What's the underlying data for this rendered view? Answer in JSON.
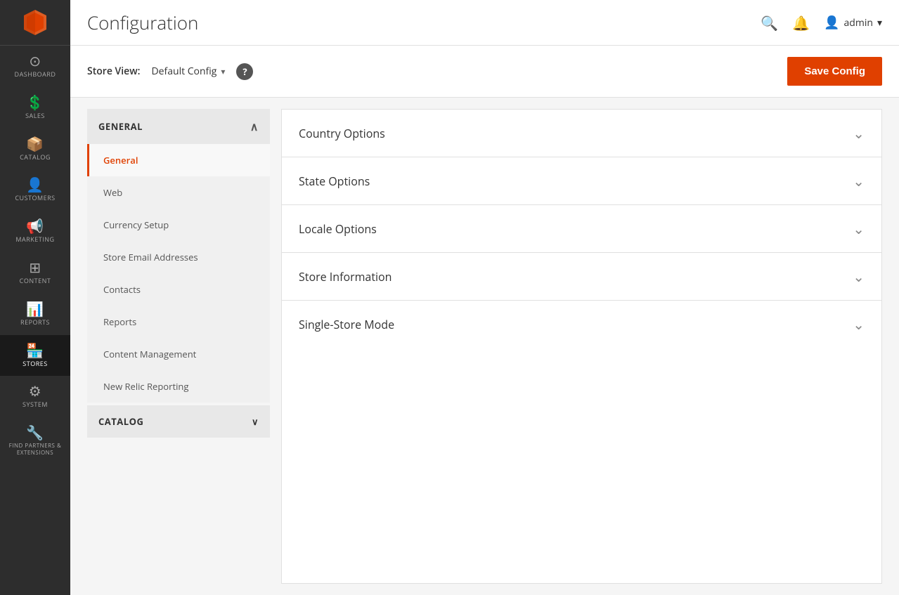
{
  "app": {
    "title": "Configuration"
  },
  "topbar": {
    "title": "Configuration",
    "user_label": "admin",
    "search_icon": "🔍",
    "bell_icon": "🔔",
    "user_icon": "👤",
    "chevron": "▾"
  },
  "store_view": {
    "label": "Store View:",
    "value": "Default Config",
    "chevron": "▾",
    "help": "?",
    "save_button": "Save Config"
  },
  "sidebar": {
    "logo_title": "Magento",
    "items": [
      {
        "id": "dashboard",
        "label": "DASHBOARD",
        "icon": "⊙"
      },
      {
        "id": "sales",
        "label": "SALES",
        "icon": "$"
      },
      {
        "id": "catalog",
        "label": "CATALOG",
        "icon": "📦"
      },
      {
        "id": "customers",
        "label": "CUSTOMERS",
        "icon": "👤"
      },
      {
        "id": "marketing",
        "label": "MARKETING",
        "icon": "📢"
      },
      {
        "id": "content",
        "label": "CONTENT",
        "icon": "⊞"
      },
      {
        "id": "reports",
        "label": "REPORTS",
        "icon": "📊"
      },
      {
        "id": "stores",
        "label": "STORES",
        "icon": "🏪"
      },
      {
        "id": "system",
        "label": "SYSTEM",
        "icon": "⚙"
      },
      {
        "id": "find-partners",
        "label": "FIND PARTNERS & EXTENSIONS",
        "icon": "🔧"
      }
    ]
  },
  "left_panel": {
    "general_section": {
      "label": "GENERAL",
      "chevron_up": "∧",
      "items": [
        {
          "id": "general",
          "label": "General",
          "active": true
        },
        {
          "id": "web",
          "label": "Web",
          "active": false
        },
        {
          "id": "currency-setup",
          "label": "Currency Setup",
          "active": false
        },
        {
          "id": "store-email-addresses",
          "label": "Store Email Addresses",
          "active": false
        },
        {
          "id": "contacts",
          "label": "Contacts",
          "active": false
        },
        {
          "id": "reports",
          "label": "Reports",
          "active": false
        },
        {
          "id": "content-management",
          "label": "Content Management",
          "active": false
        },
        {
          "id": "new-relic-reporting",
          "label": "New Relic Reporting",
          "active": false
        }
      ]
    },
    "catalog_section": {
      "label": "CATALOG",
      "chevron_down": "∨"
    }
  },
  "accordion": {
    "items": [
      {
        "id": "country-options",
        "title": "Country Options"
      },
      {
        "id": "state-options",
        "title": "State Options"
      },
      {
        "id": "locale-options",
        "title": "Locale Options"
      },
      {
        "id": "store-information",
        "title": "Store Information"
      },
      {
        "id": "single-store-mode",
        "title": "Single-Store Mode"
      }
    ],
    "chevron": "⌄"
  }
}
